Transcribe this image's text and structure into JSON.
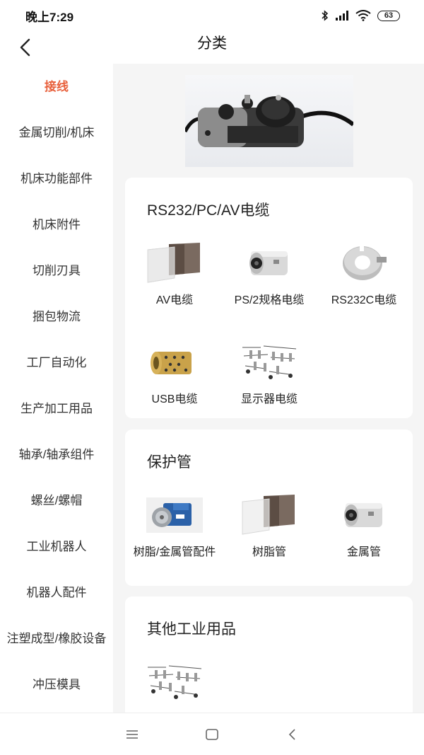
{
  "status_bar": {
    "time": "晚上7:29",
    "battery": "63"
  },
  "header": {
    "title": "分类"
  },
  "sidebar": {
    "items": [
      {
        "label": "接线",
        "active": true
      },
      {
        "label": "金属切削/机床"
      },
      {
        "label": "机床功能部件"
      },
      {
        "label": "机床附件"
      },
      {
        "label": "切削刃具"
      },
      {
        "label": "捆包物流"
      },
      {
        "label": "工厂自动化"
      },
      {
        "label": "生产加工用品"
      },
      {
        "label": "轴承/轴承组件"
      },
      {
        "label": "螺丝/螺帽"
      },
      {
        "label": "工业机器人"
      },
      {
        "label": "机器人配件"
      },
      {
        "label": "注塑成型/橡胶设备"
      },
      {
        "label": "冲压模具"
      }
    ]
  },
  "sections": [
    {
      "title": "RS232/PC/AV电缆",
      "items": [
        {
          "label": "AV电缆",
          "icon": "acrylic-cover-icon"
        },
        {
          "label": "PS/2规格电缆",
          "icon": "linear-bearing-icon"
        },
        {
          "label": "RS232C电缆",
          "icon": "shaft-collar-icon"
        },
        {
          "label": "USB电缆",
          "icon": "bushing-icon"
        },
        {
          "label": "显示器电缆",
          "icon": "sensor-cables-icon"
        }
      ]
    },
    {
      "title": "保护管",
      "items": [
        {
          "label": "树脂/金属管配件",
          "icon": "servo-motor-icon"
        },
        {
          "label": "树脂管",
          "icon": "acrylic-cover-icon"
        },
        {
          "label": "金属管",
          "icon": "linear-bearing-icon"
        }
      ]
    },
    {
      "title": "其他工业用品",
      "items": [
        {
          "label": "",
          "icon": "sensor-cables-icon"
        }
      ]
    }
  ],
  "colors": {
    "accent": "#e8603c",
    "background": "#f5f5f5",
    "card": "#ffffff"
  }
}
